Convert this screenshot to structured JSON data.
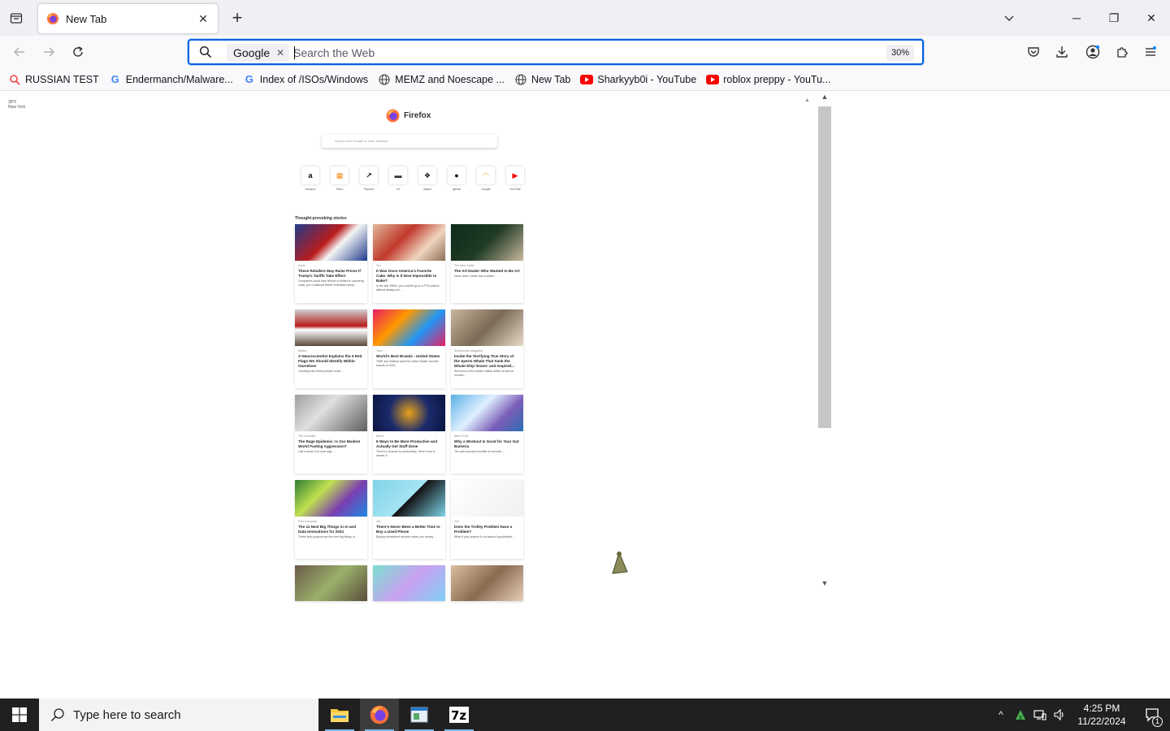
{
  "window": {
    "tab": {
      "title": "New Tab"
    },
    "controls": {
      "minimize": "─",
      "maximize": "❐",
      "close": "✕"
    }
  },
  "navbar": {
    "search_engine": "Google",
    "url_placeholder": "Search the Web",
    "zoom": "30%"
  },
  "bookmarks": [
    {
      "label": "RUSSIAN TEST",
      "icon": "search-icon"
    },
    {
      "label": "Endermanch/Malware...",
      "icon": "google-icon"
    },
    {
      "label": "Index of /ISOs/Windows",
      "icon": "google-icon"
    },
    {
      "label": "MEMZ and Noescape ...",
      "icon": "globe-icon"
    },
    {
      "label": "New Tab",
      "icon": "globe-icon"
    },
    {
      "label": "Sharkyyb0i - YouTube",
      "icon": "youtube-icon"
    },
    {
      "label": "roblox preppy - YouTu...",
      "icon": "youtube-icon"
    }
  ],
  "newtab": {
    "weather": {
      "temp": "38°F",
      "place": "New York"
    },
    "brand": "Firefox",
    "search_placeholder": "Search with Google or enter address",
    "shortcuts": [
      {
        "label": "Amazon",
        "glyph": "a",
        "color": "#000000"
      },
      {
        "label": "Temu",
        "glyph": "▦",
        "color": "#f68b1f"
      },
      {
        "label": "Popular",
        "glyph": "↗",
        "color": "#111111"
      },
      {
        "label": "Int",
        "glyph": "▬",
        "color": "#333333"
      },
      {
        "label": "Jasper",
        "glyph": "❖",
        "color": "#111111"
      },
      {
        "label": "github",
        "glyph": "●",
        "color": "#111111"
      },
      {
        "label": "Google",
        "glyph": "◠",
        "color": "#f4a20a"
      },
      {
        "label": "YouTube",
        "glyph": "▶",
        "color": "#ff0000"
      }
    ],
    "stories_title": "Thought-provoking stories",
    "stories": [
      {
        "source": "Axios",
        "headline": "These Retailers May Raise Prices If Trump's Tariffs Take Effect",
        "excerpt": "Companies could face billions of dollars in operating costs, per a National Retail Federation study.",
        "img": "linear-gradient(135deg,#1f3a8a 0%,#b91c1c 45%,#f5f5f5 60%,#1e3a8a 100%)"
      },
      {
        "source": "Vox",
        "headline": "It Was Once America's Favorite Cake. Why Is It Now Impossible to Bake?",
        "excerpt": "In the late 1960s, you couldn't go to a PTA potluck without tasting one ...",
        "img": "linear-gradient(135deg,#e0b89a 0%,#c0392b 40%,#f0d5c0 70%,#8e6e53 100%)"
      },
      {
        "source": "The New Yorker",
        "headline": "The Art Dealer Who Wanted to Be Art",
        "excerpt": "Hans Ulrich Obrist was a dealer ...",
        "img": "linear-gradient(135deg,#0e2a1a 0%,#1f3b24 50%,#c8b79e 100%)"
      },
      {
        "source": "Mother",
        "headline": "A Neuroscientist Explains the 5 Red Flags We Should Identify Within Ourselves",
        "excerpt": "Leading brain thinks people could ...",
        "img": "linear-gradient(180deg,#d0d0d0 0%,#b71c1c 45%,#ffffff 55%,#5a4a3a 100%)"
      },
      {
        "source": "Time",
        "headline": "World's Best Brands - United States",
        "excerpt": "TIME and Statista rank the United States' favorite brands of 2024.",
        "img": "linear-gradient(135deg,#e91e63 0%,#ff9800 35%,#2196f3 65%,#e91e63 100%)"
      },
      {
        "source": "Smithsonian Magazine",
        "headline": "Inside the Terrifying True Story of the Sperm Whale That Sank the Whale-Ship 'Essex' and Inspired...",
        "excerpt": "Survivors of the whale's attack drifted at sea for months...",
        "img": "linear-gradient(135deg,#c8b79e 0%,#7a6a55 50%,#e8dcc8 100%)"
      },
      {
        "source": "The Guardian",
        "headline": "The Rage Epidemic: Is Our Modern World Fueling Aggression?",
        "excerpt": "Like a storm of a road rage ...",
        "img": "linear-gradient(135deg,#9e9e9e 0%,#e0e0e0 40%,#5d5d5d 100%)"
      },
      {
        "source": "Wired",
        "headline": "6 Ways to Be More Productive and Actually Get Stuff Done",
        "excerpt": "There's a science to productivity. Here's how to master it.",
        "img": "radial-gradient(circle at 50% 50%,#e6a21a 0%,#1b2a6b 50%,#0a1440 100%)"
      },
      {
        "source": "Well+Good",
        "headline": "Why a Workout Is Good for Your Gut Bacteria",
        "excerpt": "The well-rounded benefits of exercise ...",
        "img": "linear-gradient(135deg,#5ab0e6 0%,#e0f0ff 40%,#7a5cb8 70%,#2a6fb0 100%)"
      },
      {
        "source": "Fast Company",
        "headline": "The 11 Next Big Things in AI and Data Innovations for 2024",
        "excerpt": "These tech projects are the next big things in ...",
        "img": "linear-gradient(135deg,#2e7d32 0%,#c0e050 35%,#7b3fb0 65%,#1e88e5 100%)"
      },
      {
        "source": "Vox",
        "headline": "There's Never Been a Better Time to Buy a Used Phone",
        "excerpt": "Buying refurbished devices saves you money ...",
        "img": "linear-gradient(135deg,#7fd3e8 0%,#a5e4f3 50%,#111 51%,#7fd3e8 100%)"
      },
      {
        "source": "Vox",
        "headline": "Does the Trolley Problem Have a Problem?",
        "excerpt": "What if your answer to an absurd hypothetical ...",
        "img": "linear-gradient(135deg,#ffffff 0%,#f0f0f0 100%)"
      },
      {
        "source": "",
        "headline": "",
        "excerpt": "",
        "img": "linear-gradient(135deg,#6d5a4a 0%,#9ab06a 50%,#5a4a3a 100%)"
      },
      {
        "source": "",
        "headline": "",
        "excerpt": "",
        "img": "linear-gradient(135deg,#7be0d0 0%,#c9a0f0 50%,#7fd0f5 100%)"
      },
      {
        "source": "",
        "headline": "",
        "excerpt": "",
        "img": "linear-gradient(135deg,#d9c0a0 0%,#8a6a50 50%,#e8d0b8 100%)"
      }
    ]
  },
  "taskbar": {
    "search_placeholder": "Type here to search",
    "time": "4:25 PM",
    "date": "11/22/2024",
    "notification_count": "1",
    "accent": "#76b9ed"
  }
}
